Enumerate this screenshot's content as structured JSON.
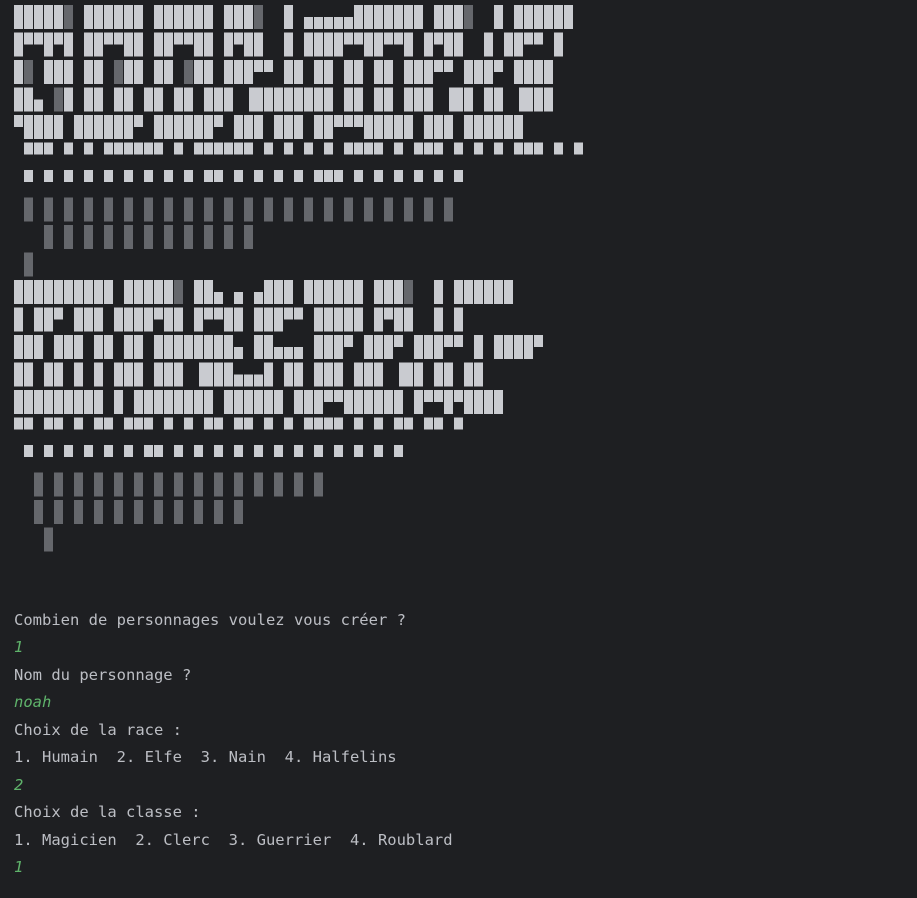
{
  "theme": {
    "background": "#1e1f22",
    "text_color": "#bcbec4",
    "input_color": "#5fb36b",
    "block_light": "#c9cbd0",
    "block_dark": "#7e8085"
  },
  "banner": {
    "rows": [
      "█████░ ██████ ██████ ███░  █ ▄▄▄▄▄███████ ███░  █ ██████",
      "█▀▀█▀█ ██▀▀██ ██▀▀██ █▀██  █ ████▀▀██▀▀█ █▀██  █ ██▀▀ █",
      "█░ ███ ██ ░██ ██ ░██ ███▀▀ ██ ██ ██ ██ ███▀▀ ███▀ ████",
      "██▄ ░█ ██ ██ ██ ██ ███ ▐████████ ██ ██ ███ ▐██ ██ ▐███",
      "▀████ ██████▀ ██████▀ ███ ███ ██▀▀▀█████ ███ ██████",
      " ▀▀▀ ▀ ▀ ▀▀▀▀▀▀ ▀ ▀▀▀▀▀▀ ▀ ▀ ▀ ▀ ▀▀▀▀ ▀ ▀▀▀ ▀ ▀ ▀ ▀▀▀ ▀ ▀",
      " ▀ ▀ ▀ ▀ ▀ ▀ ▀ ▀ ▀ ▀▀ ▀ ▀ ▀ ▀ ▀▀▀ ▀ ▀ ▀ ▀ ▀ ▀",
      " ░ ░ ░ ░ ░ ░ ░ ░ ░ ░ ░ ░ ░ ░ ░ ░ ░ ░ ░ ░ ░ ░",
      "   ░ ░ ░ ░ ░ ░ ░ ░ ░ ░ ░",
      " ░",
      "██████████ █████░ ██▄ ▄ ▄███ ██████ ███░  █ ██████",
      "█ ██▀ ███ ████▀██ █▀▀██ ███▀▀ █████ █▀██  █ █",
      "███ ███ ██ ██ ████████▄ ██▄▄▄ ███▀ ███▀ ███▀▀ █ ████▀",
      "██ ██ █ █ ███ ███ ▐███▄▄▄█ ██ ███ ███ ▐██ ██ ██",
      "█████████ █ ████████ ██████ ███▀▀██████ █▀▀█▀████",
      "▀▀ ▀▀ ▀ ▀▀ ▀▀▀ ▀ ▀ ▀▀ ▀▀ ▀ ▀ ▀▀▀▀ ▀ ▀ ▀▀ ▀▀ ▀",
      " ▀ ▀ ▀ ▀ ▀ ▀ ▀▀ ▀ ▀ ▀ ▀ ▀ ▀ ▀ ▀ ▀ ▀ ▀ ▀",
      "  ░ ░ ░ ░ ░ ░ ░ ░ ░ ░ ░ ░ ░ ░ ░",
      "  ░ ░ ░ ░ ░ ░ ░ ░ ░ ░ ░",
      "   ░"
    ]
  },
  "lines": [
    {
      "text": "Combien de personnages voulez vous créer ?",
      "kind": "prompt"
    },
    {
      "text": "1",
      "kind": "input"
    },
    {
      "text": "Nom du personnage ?",
      "kind": "prompt"
    },
    {
      "text": "noah",
      "kind": "input"
    },
    {
      "text": "Choix de la race :",
      "kind": "prompt"
    },
    {
      "text": "1. Humain  2. Elfe  3. Nain  4. Halfelins",
      "kind": "prompt"
    },
    {
      "text": "2",
      "kind": "input"
    },
    {
      "text": "Choix de la classe :",
      "kind": "prompt"
    },
    {
      "text": "1. Magicien  2. Clerc  3. Guerrier  4. Roublard",
      "kind": "prompt"
    },
    {
      "text": "1",
      "kind": "input"
    }
  ]
}
